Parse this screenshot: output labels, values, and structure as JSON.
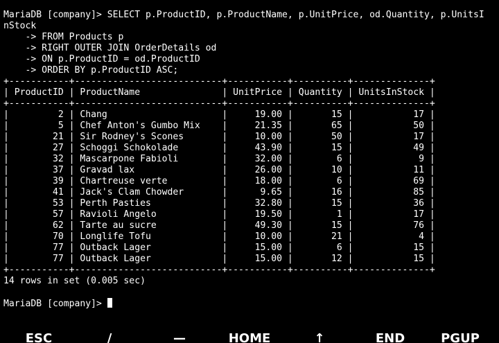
{
  "terminal": {
    "lines": [
      "MariaDB [company]> SELECT p.ProductID, p.ProductName, p.UnitPrice, od.Quantity, p.UnitsI",
      "nStock",
      "    -> FROM Products p",
      "    -> RIGHT OUTER JOIN OrderDetails od",
      "    -> ON p.ProductID = od.ProductID",
      "    -> ORDER BY p.ProductID ASC;",
      "+-----------+---------------------------+-----------+----------+--------------+",
      "| ProductID | ProductName               | UnitPrice | Quantity | UnitsInStock |",
      "+-----------+---------------------------+-----------+----------+--------------+",
      "|         2 | Chang                     |     19.00 |       15 |           17 |",
      "|         5 | Chef Anton's Gumbo Mix    |     21.35 |       65 |           50 |",
      "|        21 | Sir Rodney's Scones       |     10.00 |       50 |           17 |",
      "|        27 | Schoggi Schokolade        |     43.90 |       15 |           49 |",
      "|        32 | Mascarpone Fabioli        |     32.00 |        6 |            9 |",
      "|        37 | Gravad lax                |     26.00 |       10 |           11 |",
      "|        39 | Chartreuse verte          |     18.00 |        6 |           69 |",
      "|        41 | Jack's Clam Chowder       |      9.65 |       16 |           85 |",
      "|        53 | Perth Pasties             |     32.80 |       15 |           36 |",
      "|        57 | Ravioli Angelo            |     19.50 |        1 |           17 |",
      "|        62 | Tarte au sucre            |     49.30 |       15 |           76 |",
      "|        70 | Longlife Tofu             |     10.00 |       21 |            4 |",
      "|        77 | Outback Lager             |     15.00 |        6 |           15 |",
      "|        77 | Outback Lager             |     15.00 |       12 |           15 |",
      "+-----------+---------------------------+-----------+----------+--------------+",
      "14 rows in set (0.005 sec)",
      ""
    ],
    "prompt": "MariaDB [company]> "
  },
  "keybar": {
    "keys": [
      "ESC",
      "/",
      "—",
      "HOME",
      "↑",
      "END",
      "PGUP"
    ]
  }
}
